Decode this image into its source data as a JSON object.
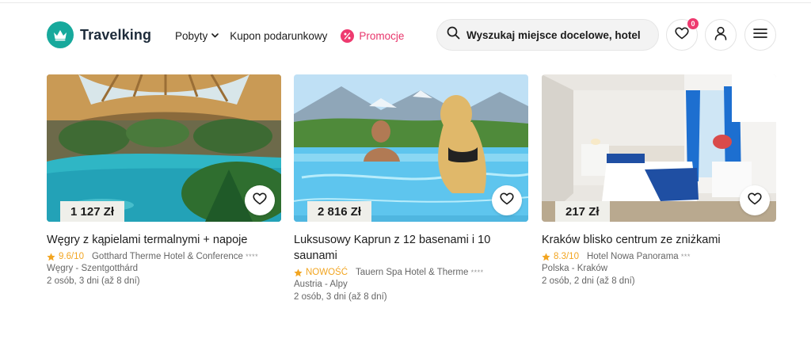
{
  "brand": {
    "name": "Travelking",
    "accent": "#17a99c"
  },
  "nav": {
    "pobyty": "Pobyty",
    "kupon": "Kupon podarunkowy",
    "promocje": "Promocje",
    "promo_color": "#e8356b"
  },
  "search": {
    "placeholder": "Wyszukaj miejsce docelowe, hotel"
  },
  "header_actions": {
    "favorites_count": "0"
  },
  "cards": [
    {
      "price": "1 127 Zł",
      "title": "Węgry z kąpielami termalnymi + napoje",
      "rating": "9.6/10",
      "hotel": "Gotthard Therme Hotel & Conference",
      "hotel_stars": "****",
      "location": "Węgry - Szentgotthárd",
      "duration": "2 osób, 3 dni (až 8 dní)"
    },
    {
      "price": "2 816 Zł",
      "title": "Luksusowy Kaprun z 12 basenami i 10 saunami",
      "rating": "NOWOŚĆ",
      "hotel": "Tauern Spa Hotel & Therme",
      "hotel_stars": "****",
      "location": "Austria - Alpy",
      "duration": "2 osób, 3 dni (až 8 dní)"
    },
    {
      "price": "217 Zł",
      "title": "Kraków blisko centrum ze zniżkami",
      "rating": "8.3/10",
      "hotel": "Hotel Nowa Panorama",
      "hotel_stars": "***",
      "location": "Polska - Kraków",
      "duration": "2 osób, 2 dni (až 8 dní)"
    }
  ]
}
